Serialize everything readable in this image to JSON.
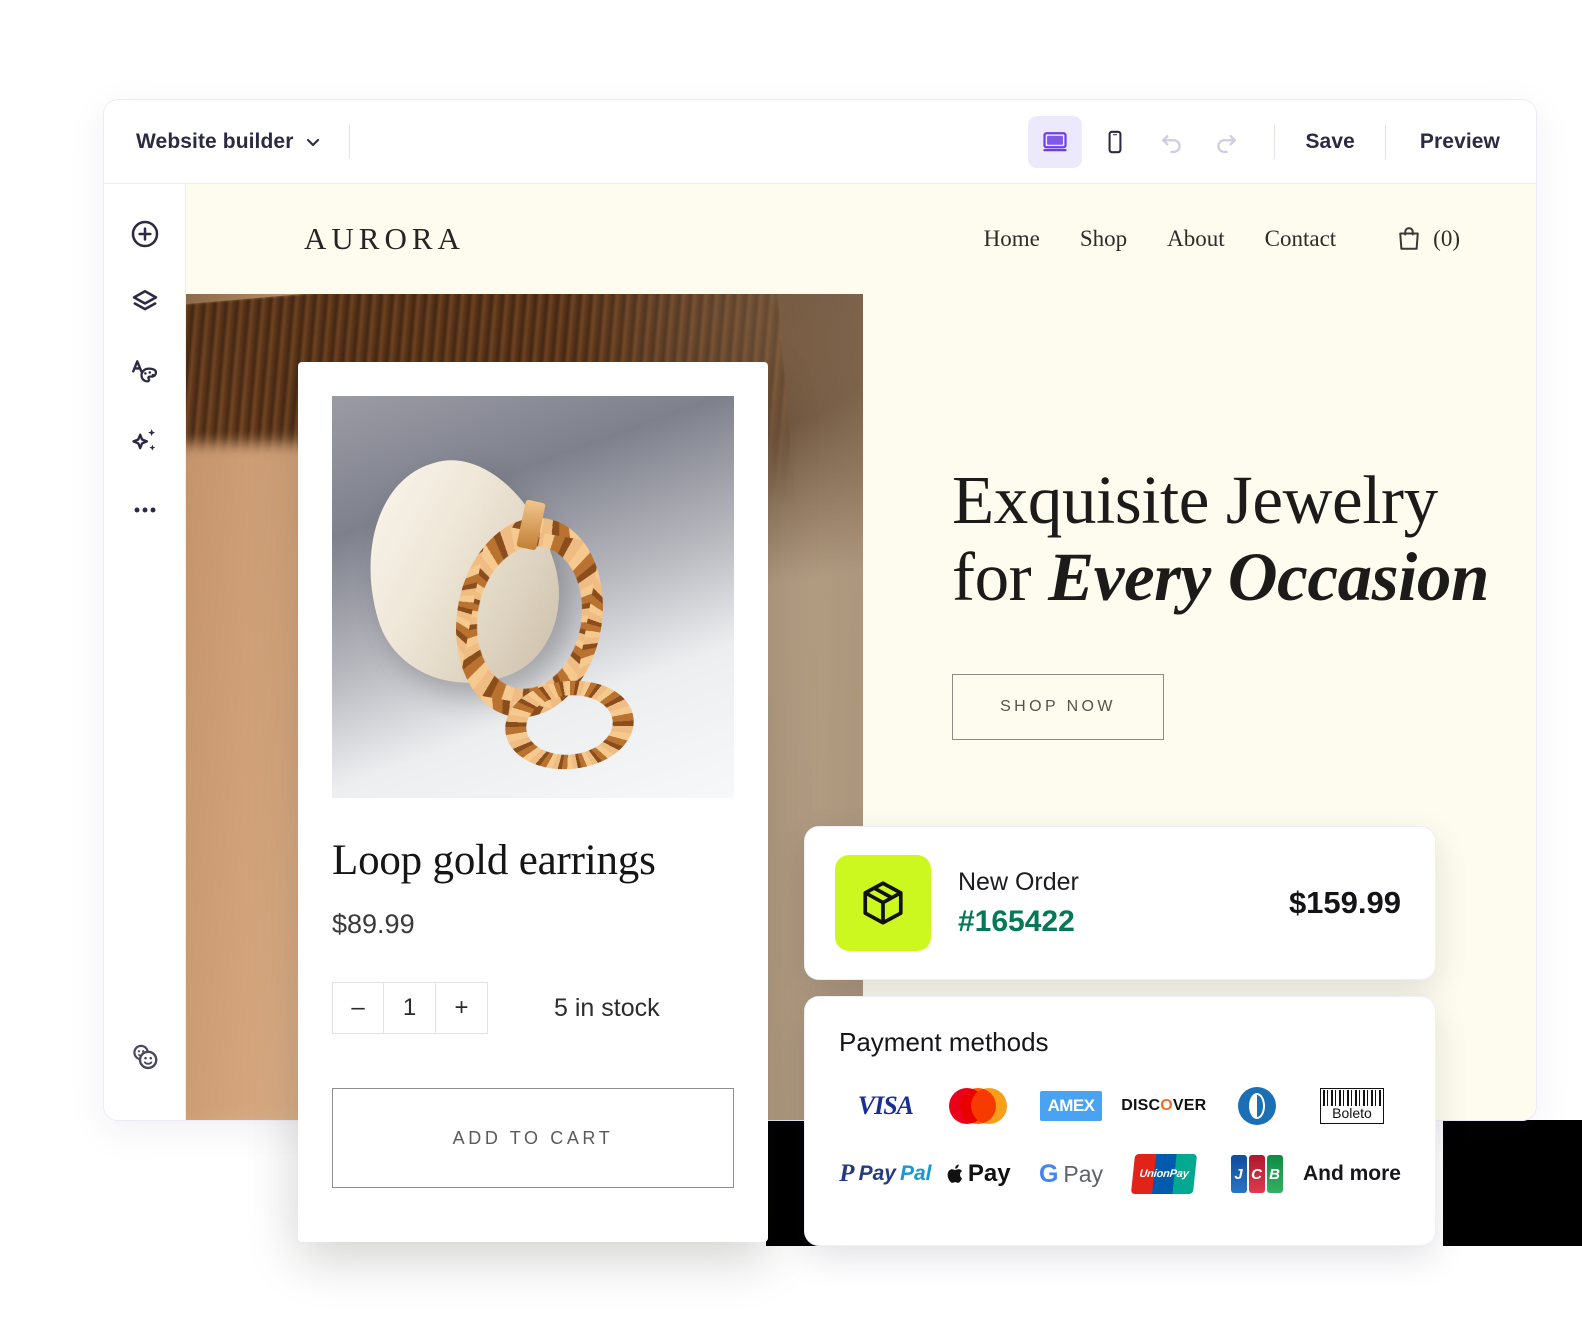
{
  "builder": {
    "menu_label": "Website builder",
    "menu_icon": "chevron-down-icon",
    "viewport": {
      "desktop_icon": "desktop-monitor-icon",
      "mobile_icon": "mobile-phone-icon",
      "active": "desktop"
    },
    "undo_icon": "undo-arrow-icon",
    "redo_icon": "redo-arrow-icon",
    "save_label": "Save",
    "preview_label": "Preview",
    "rail": [
      {
        "name": "add",
        "icon": "circle-plus-icon"
      },
      {
        "name": "layers",
        "icon": "layers-icon"
      },
      {
        "name": "theme",
        "icon": "text-palette-icon"
      },
      {
        "name": "ai",
        "icon": "sparkles-icon"
      },
      {
        "name": "more",
        "icon": "ellipsis-icon"
      },
      {
        "name": "collaborators",
        "icon": "two-faces-icon"
      }
    ]
  },
  "site": {
    "brand": "AURORA",
    "nav": [
      "Home",
      "Shop",
      "About",
      "Contact"
    ],
    "cart_icon": "shopping-bag-icon",
    "cart_count": "(0)",
    "hero": {
      "title_line1": "Exquisite Jewelry",
      "title_line2_plain": "for ",
      "title_line2_emph": "Every Occasion",
      "cta_label": "SHOP NOW"
    }
  },
  "product": {
    "photo_alt": "gold-loop-earrings-photo",
    "title": "Loop gold earrings",
    "price": "$89.99",
    "qty_minus": "–",
    "qty_value": "1",
    "qty_plus": "+",
    "stock": "5 in stock",
    "add_to_cart_label": "ADD TO CART"
  },
  "order": {
    "icon": "package-box-icon",
    "label": "New Order",
    "id": "#165422",
    "amount": "$159.99",
    "accent_color": "#ccf81f",
    "id_color": "#047857"
  },
  "payments": {
    "title": "Payment methods",
    "methods": [
      "VISA",
      "Mastercard",
      "AMEX",
      "DISCOVER",
      "Diners Club",
      "Boleto",
      "PayPal",
      "Apple Pay",
      "Google Pay",
      "UnionPay",
      "JCB",
      "And more"
    ],
    "visa_label": "VISA",
    "amex_label": "AMEX",
    "discover_pre": "DISC",
    "discover_dot": "O",
    "discover_post": "VER",
    "boleto_label": "Boleto",
    "paypal_icon": "P",
    "paypal_a": "Pay",
    "paypal_b": "Pal",
    "applepay_label": "Pay",
    "gpay_g": "G",
    "gpay_pay": "Pay",
    "unionpay_label": "UnionPay",
    "jcb_j": "J",
    "jcb_c": "C",
    "jcb_b": "B",
    "and_more_label": "And more"
  }
}
